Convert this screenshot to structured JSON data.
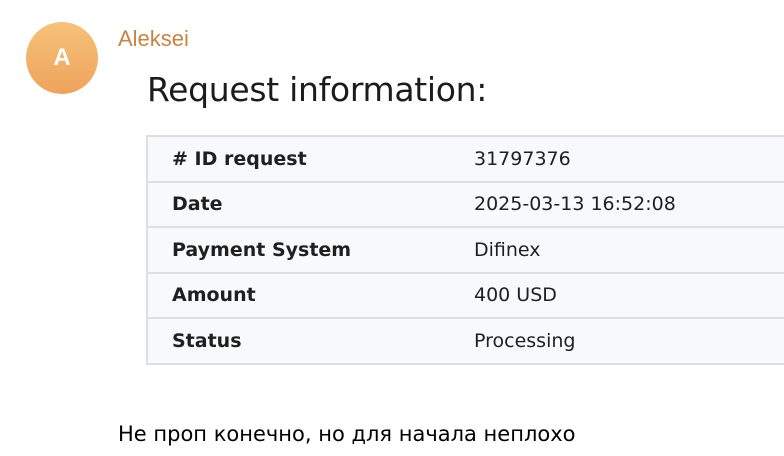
{
  "message": {
    "avatar_letter": "A",
    "sender_name": "Aleksei",
    "card": {
      "title": "Request information:",
      "rows": [
        {
          "label": "# ID request",
          "value": "31797376"
        },
        {
          "label": "Date",
          "value": "2025-03-13 16:52:08"
        },
        {
          "label": "Payment System",
          "value": "Difinex"
        },
        {
          "label": "Amount",
          "value": "400 USD"
        },
        {
          "label": "Status",
          "value": "Processing"
        }
      ]
    },
    "text": "Не проп конечно, но для начала неплохо"
  },
  "colors": {
    "avatar_gradient_top": "#f6c27a",
    "avatar_gradient_bottom": "#eea35c",
    "sender_name": "#c98344",
    "table_background": "#f8f9fa",
    "table_border": "#dde0e3"
  }
}
